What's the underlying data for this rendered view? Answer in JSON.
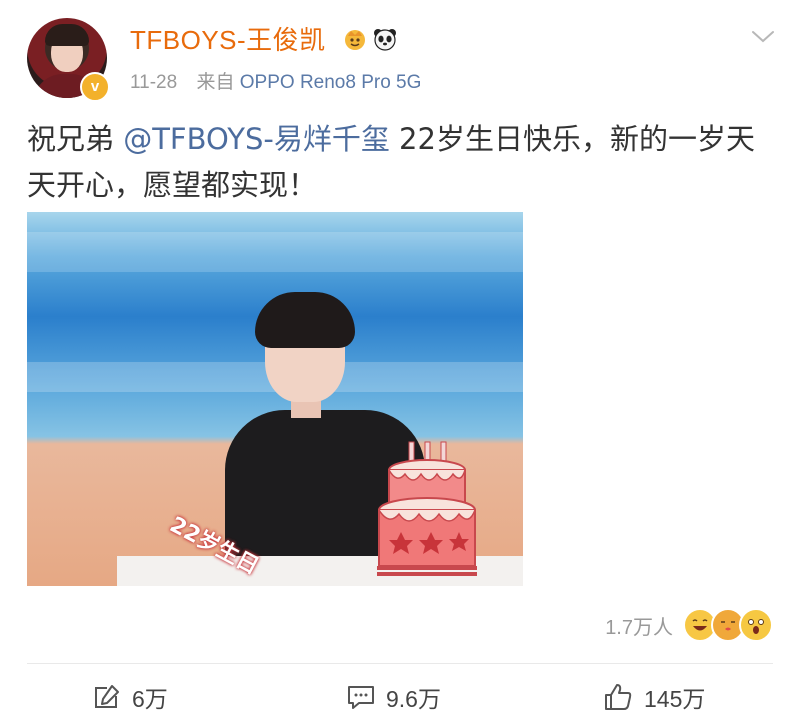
{
  "post": {
    "author": "TFBOYS-王俊凯",
    "author_icons": [
      "crown-badge-icon",
      "panda-icon"
    ],
    "time": "11-28",
    "source_prefix": "来自",
    "source_device": "OPPO Reno8 Pro 5G",
    "content": {
      "prefix": "祝兄弟 ",
      "mention": "@TFBOYS-易烊千玺",
      "suffix": " 22岁生日快乐，新的一岁天天开心，愿望都实现！"
    },
    "image": {
      "sticker_text": "22岁生日"
    },
    "reactions": {
      "count": "1.7万人",
      "emojis": [
        "laugh-emoji-icon",
        "kiss-emoji-icon",
        "surprised-emoji-icon"
      ]
    },
    "actions": {
      "repost": "6万",
      "comment": "9.6万",
      "like": "145万"
    }
  },
  "colors": {
    "author": "#e86b0c",
    "mention": "#4c6c9e",
    "meta": "#999999"
  }
}
